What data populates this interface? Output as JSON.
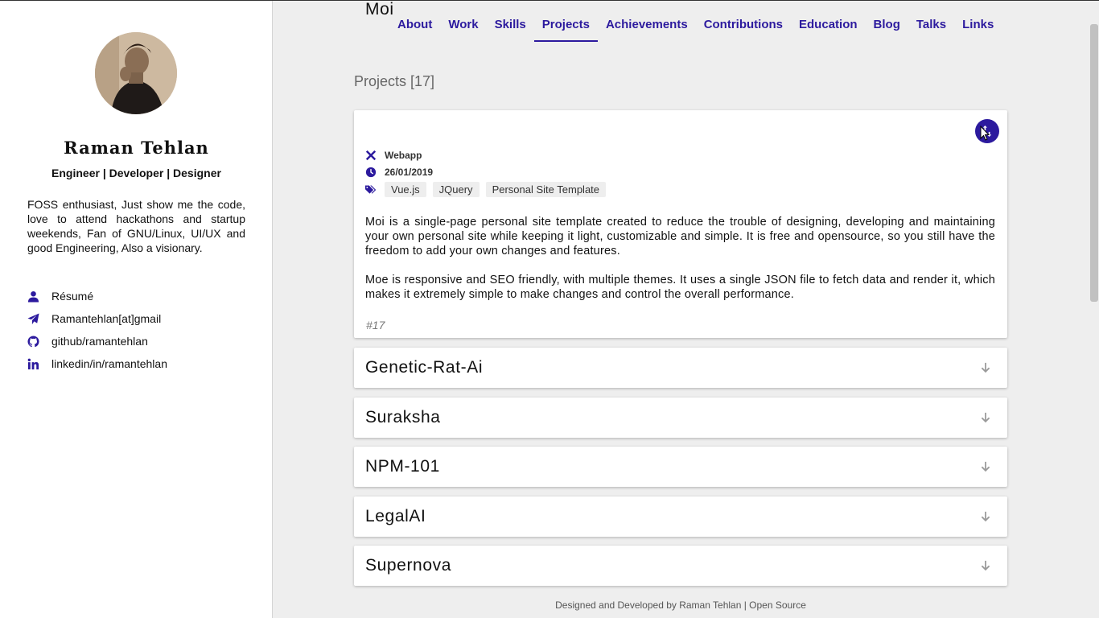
{
  "sidebar": {
    "name": "Raman Tehlan",
    "tagline": "Engineer | Developer | Designer",
    "bio": "FOSS enthusiast, Just show me the code, love to attend hackathons and startup weekends, Fan of GNU/Linux, UI/UX and good Engineering, Also a visionary.",
    "contacts": [
      {
        "icon": "user-icon",
        "label": "Résumé"
      },
      {
        "icon": "paper-plane-icon",
        "label": "Ramantehlan[at]gmail"
      },
      {
        "icon": "github-icon",
        "label": "github/ramantehlan"
      },
      {
        "icon": "linkedin-icon",
        "label": "linkedin/in/ramantehlan"
      }
    ]
  },
  "nav": {
    "items": [
      "About",
      "Work",
      "Skills",
      "Projects",
      "Achievements",
      "Contributions",
      "Education",
      "Blog",
      "Talks",
      "Links"
    ],
    "active": "Projects"
  },
  "projects": {
    "heading": "Projects [17]",
    "open": {
      "title": "Moi",
      "type": "Webapp",
      "date": "26/01/2019",
      "tags": [
        "Vue.js",
        "JQuery",
        "Personal Site Template"
      ],
      "desc1": "Moi is a single-page personal site template created to reduce the trouble of designing, developing and maintaining your own personal site while keeping it light, customizable and simple. It is free and opensource, so you still have the freedom to add your own changes and features.",
      "desc2": "Moe is responsive and SEO friendly, with multiple themes. It uses a single JSON file to fetch data and render it, which makes it extremely simple to make changes and control the overall performance.",
      "id": "#17"
    },
    "collapsed": [
      "Genetic-Rat-Ai",
      "Suraksha",
      "NPM-101",
      "LegalAI",
      "Supernova"
    ]
  },
  "footer": {
    "text": "Designed and Developed by Raman Tehlan | ",
    "link": "Open Source"
  },
  "colors": {
    "accent": "#2c1a9e",
    "background": "#eeeeee",
    "card": "#ffffff"
  }
}
